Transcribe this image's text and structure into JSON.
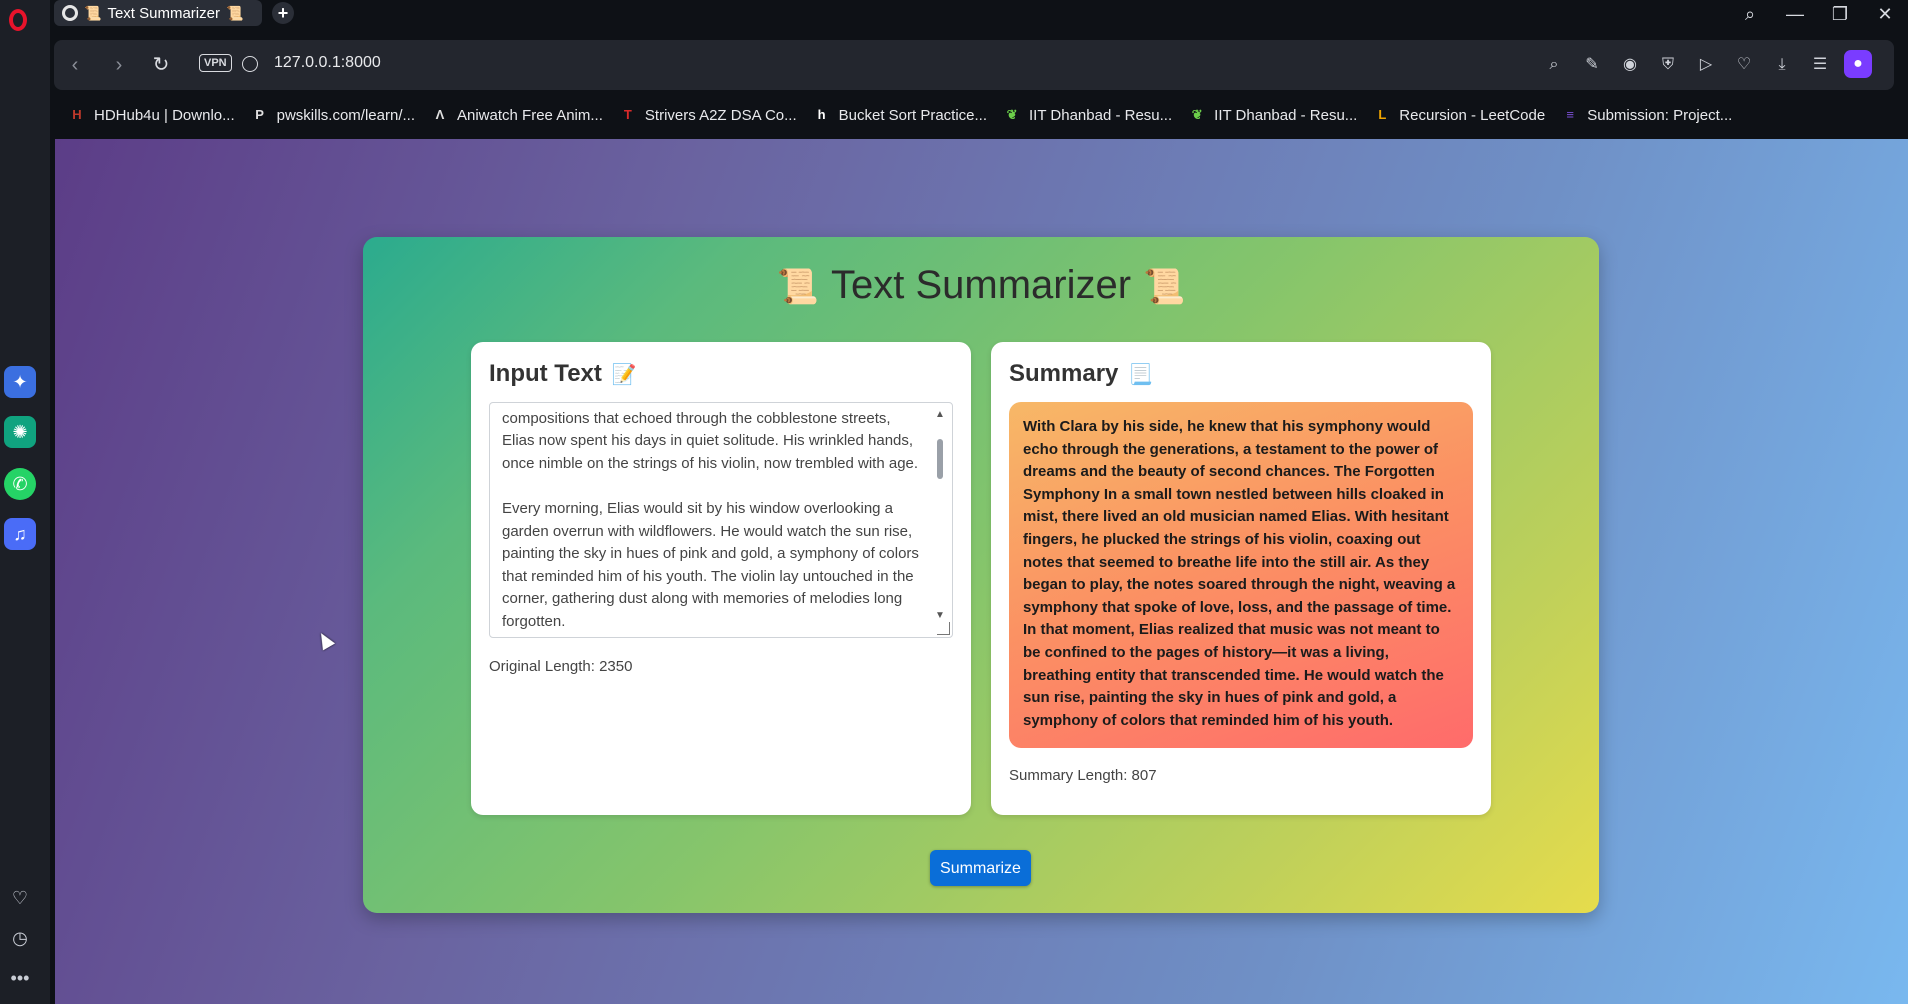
{
  "browser": {
    "tab": {
      "title": "Text Summarizer",
      "emoji": "📜"
    },
    "url": "127.0.0.1:8000",
    "vpn_label": "VPN",
    "bookmarks": [
      {
        "label": "HDHub4u | Downlo...",
        "color": "#c0392b",
        "glyph": "H"
      },
      {
        "label": "pwskills.com/learn/...",
        "color": "#e0e0e0",
        "glyph": "P"
      },
      {
        "label": "Aniwatch Free Anim...",
        "color": "#e0e0e0",
        "glyph": "Λ"
      },
      {
        "label": "Strivers A2Z DSA Co...",
        "color": "#d92a2a",
        "glyph": "T"
      },
      {
        "label": "Bucket Sort Practice...",
        "color": "#ffffff",
        "glyph": "h"
      },
      {
        "label": "IIT Dhanbad - Resu...",
        "color": "#6ccf4a",
        "glyph": "❦"
      },
      {
        "label": "IIT Dhanbad - Resu...",
        "color": "#6ccf4a",
        "glyph": "❦"
      },
      {
        "label": "Recursion - LeetCode",
        "color": "#f0a500",
        "glyph": "L"
      },
      {
        "label": "Submission: Project...",
        "color": "#7b4fd6",
        "glyph": "≡"
      }
    ]
  },
  "app": {
    "title": "Text Summarizer",
    "title_emoji": "📜",
    "input": {
      "heading": "Input Text",
      "heading_emoji": "📝",
      "text": "lived an old musician named Elias. Once celebrated for his compositions that echoed through the cobblestone streets, Elias now spent his days in quiet solitude. His wrinkled hands, once nimble on the strings of his violin, now trembled with age.\n\nEvery morning, Elias would sit by his window overlooking a garden overrun with wildflowers. He would watch the sun rise, painting the sky in hues of pink and gold, a symphony of colors that reminded him of his youth. The violin lay untouched in the corner, gathering dust along with memories of melodies long forgotten.",
      "length_label": "Original Length: 2350"
    },
    "summary": {
      "heading": "Summary",
      "heading_emoji": "📃",
      "text": "With Clara by his side, he knew that his symphony would echo through the generations, a testament to the power of dreams and the beauty of second chances. The Forgotten Symphony In a small town nestled between hills cloaked in mist, there lived an old musician named Elias. With hesitant fingers, he plucked the strings of his violin, coaxing out notes that seemed to breathe life into the still air. As they began to play, the notes soared through the night, weaving a symphony that spoke of love, loss, and the passage of time. In that moment, Elias realized that music was not meant to be confined to the pages of history—it was a living, breathing entity that transcended time. He would watch the sun rise, painting the sky in hues of pink and gold, a symphony of colors that reminded him of his youth.",
      "length_label": "Summary Length: 807"
    },
    "button_label": "Summarize"
  }
}
